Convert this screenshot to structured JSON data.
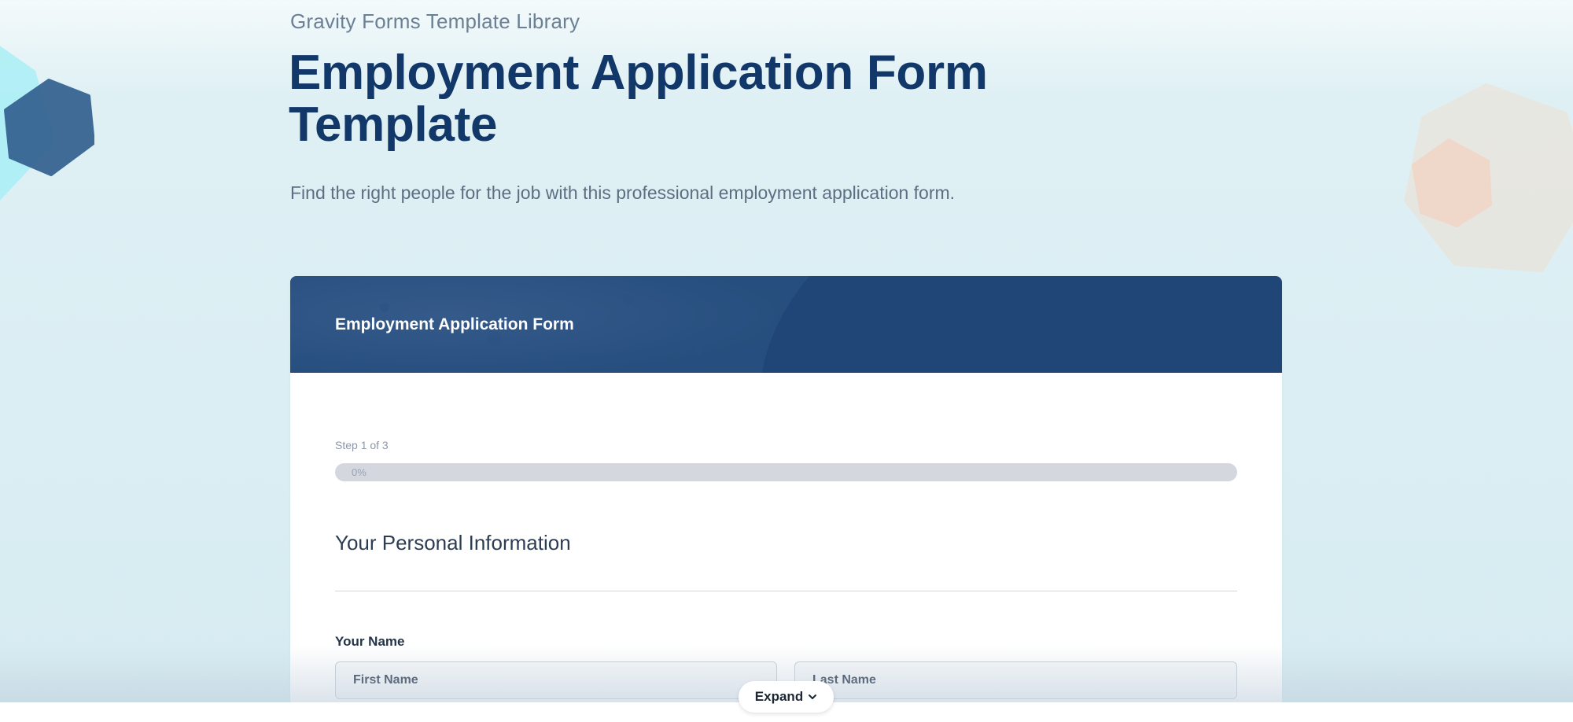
{
  "hero": {
    "library_link": "Gravity Forms Template Library",
    "title": "Employment Application Form Template",
    "description": "Find the right people for the job with this professional employment application form."
  },
  "form": {
    "header_title": "Employment Application Form",
    "step_label": "Step 1 of 3",
    "progress": {
      "percent": 0,
      "label": "0%"
    },
    "section_title": "Your Personal Information",
    "name_field": {
      "label": "Your Name",
      "first_placeholder": "First Name",
      "last_placeholder": "Last Name"
    }
  },
  "footer": {
    "expand_label": "Expand",
    "expand_icon": "chevron-down-icon"
  },
  "colors": {
    "title": "#12386a",
    "header_bg": "#1f4677",
    "deco_dark": "#2e5e8e",
    "deco_light": "#aeeef5",
    "deco_peach": "#f1cfbd"
  }
}
